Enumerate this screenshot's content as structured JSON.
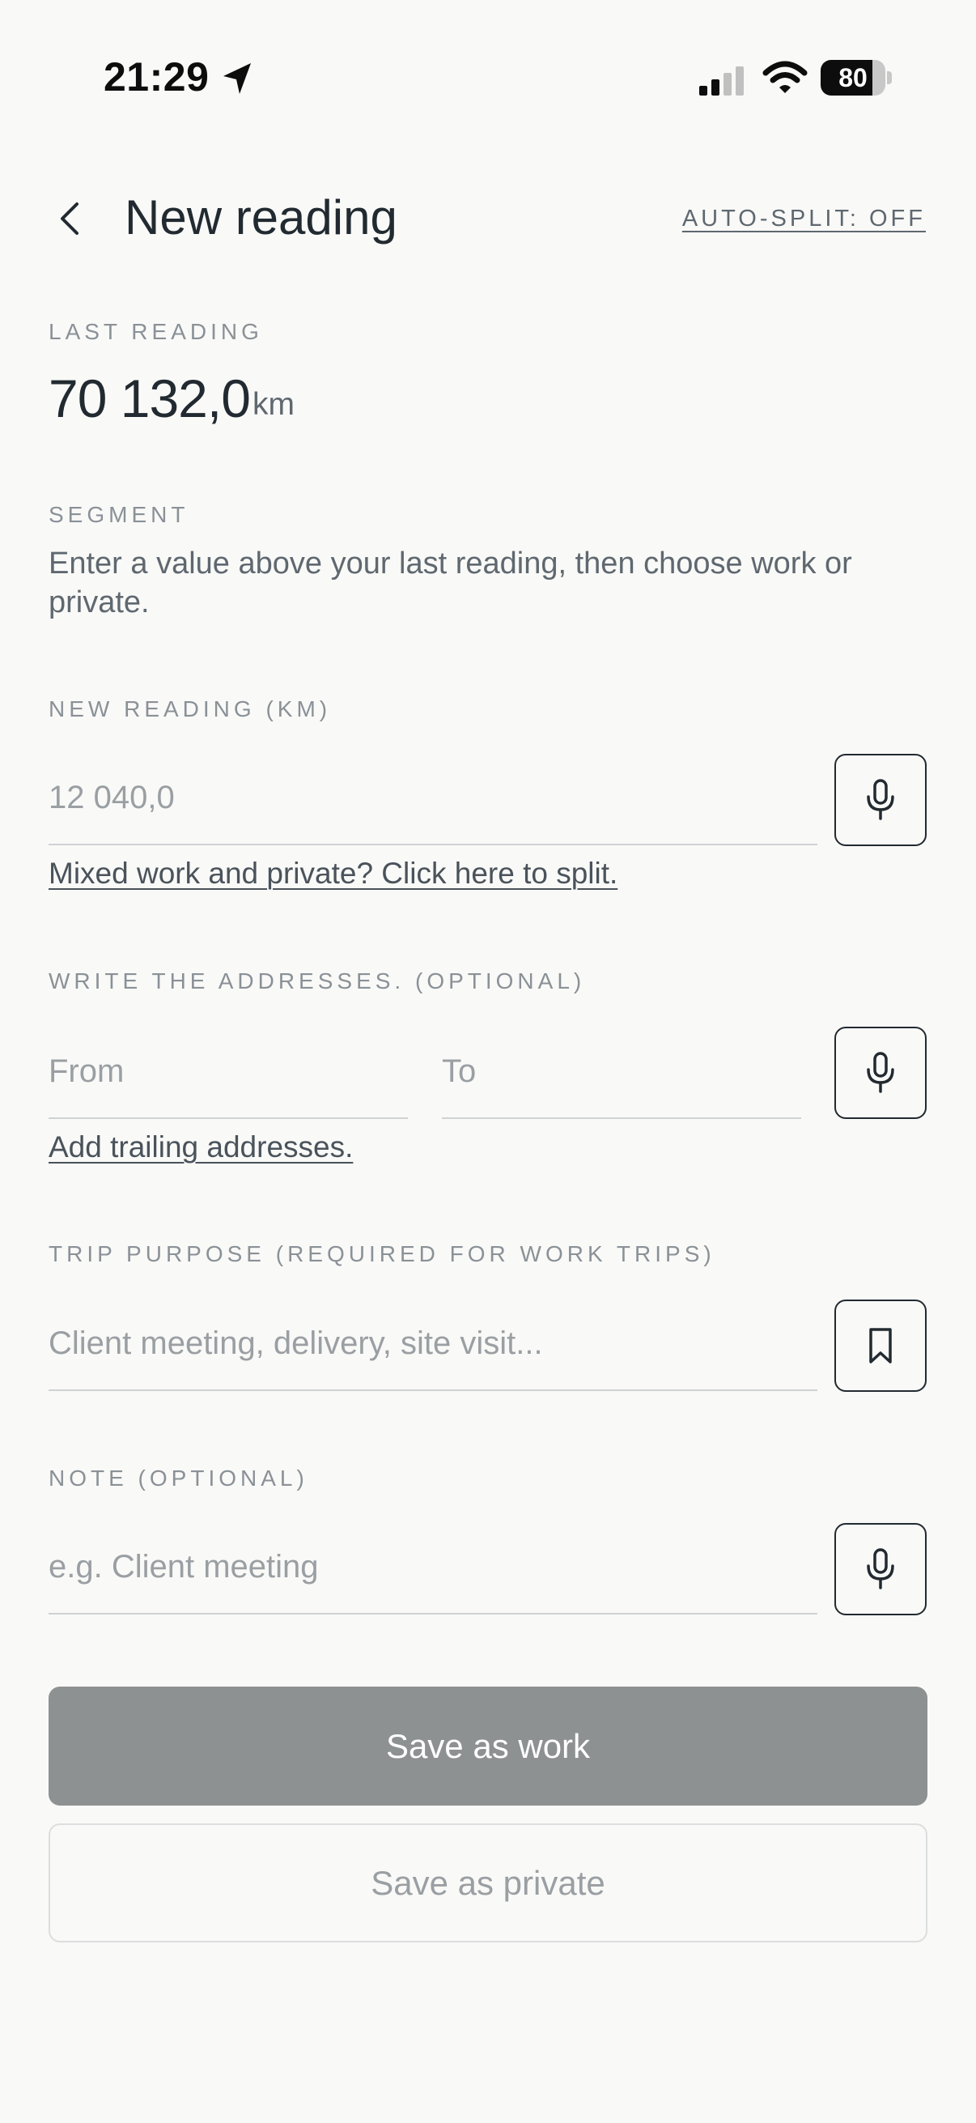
{
  "status_bar": {
    "time": "21:29",
    "battery": "80",
    "battery_level": 0.8,
    "icons": [
      "location-arrow-icon",
      "signal-icon",
      "wifi-icon",
      "battery-icon"
    ]
  },
  "header": {
    "title": "New reading",
    "auto_split": "AUTO-SPLIT: OFF"
  },
  "last_reading": {
    "label": "LAST READING",
    "value": "70 132,0",
    "unit": "km"
  },
  "segment": {
    "label": "SEGMENT",
    "text": "Enter a value above your last reading, then choose work or private."
  },
  "new_reading": {
    "label": "NEW READING (KM)",
    "placeholder": "12 040,0",
    "split_link": "Mixed work and private? Click here to split."
  },
  "addresses": {
    "label": "WRITE THE ADDRESSES. (OPTIONAL)",
    "from_placeholder": "From",
    "to_placeholder": "To",
    "trailing_link": "Add trailing addresses."
  },
  "trip_purpose": {
    "label": "TRIP PURPOSE (REQUIRED FOR WORK TRIPS)",
    "placeholder": "Client meeting, delivery, site visit..."
  },
  "note": {
    "label": "NOTE (OPTIONAL)",
    "placeholder": "e.g. Client meeting"
  },
  "actions": {
    "save_work": "Save as work",
    "save_private": "Save as private"
  },
  "colors": {
    "background": "#f9f9f7",
    "text_primary": "#222a31",
    "text_secondary": "#5f6870",
    "label": "#8a9197",
    "placeholder": "#9a9fa3",
    "disabled_button": "#8e9192"
  }
}
